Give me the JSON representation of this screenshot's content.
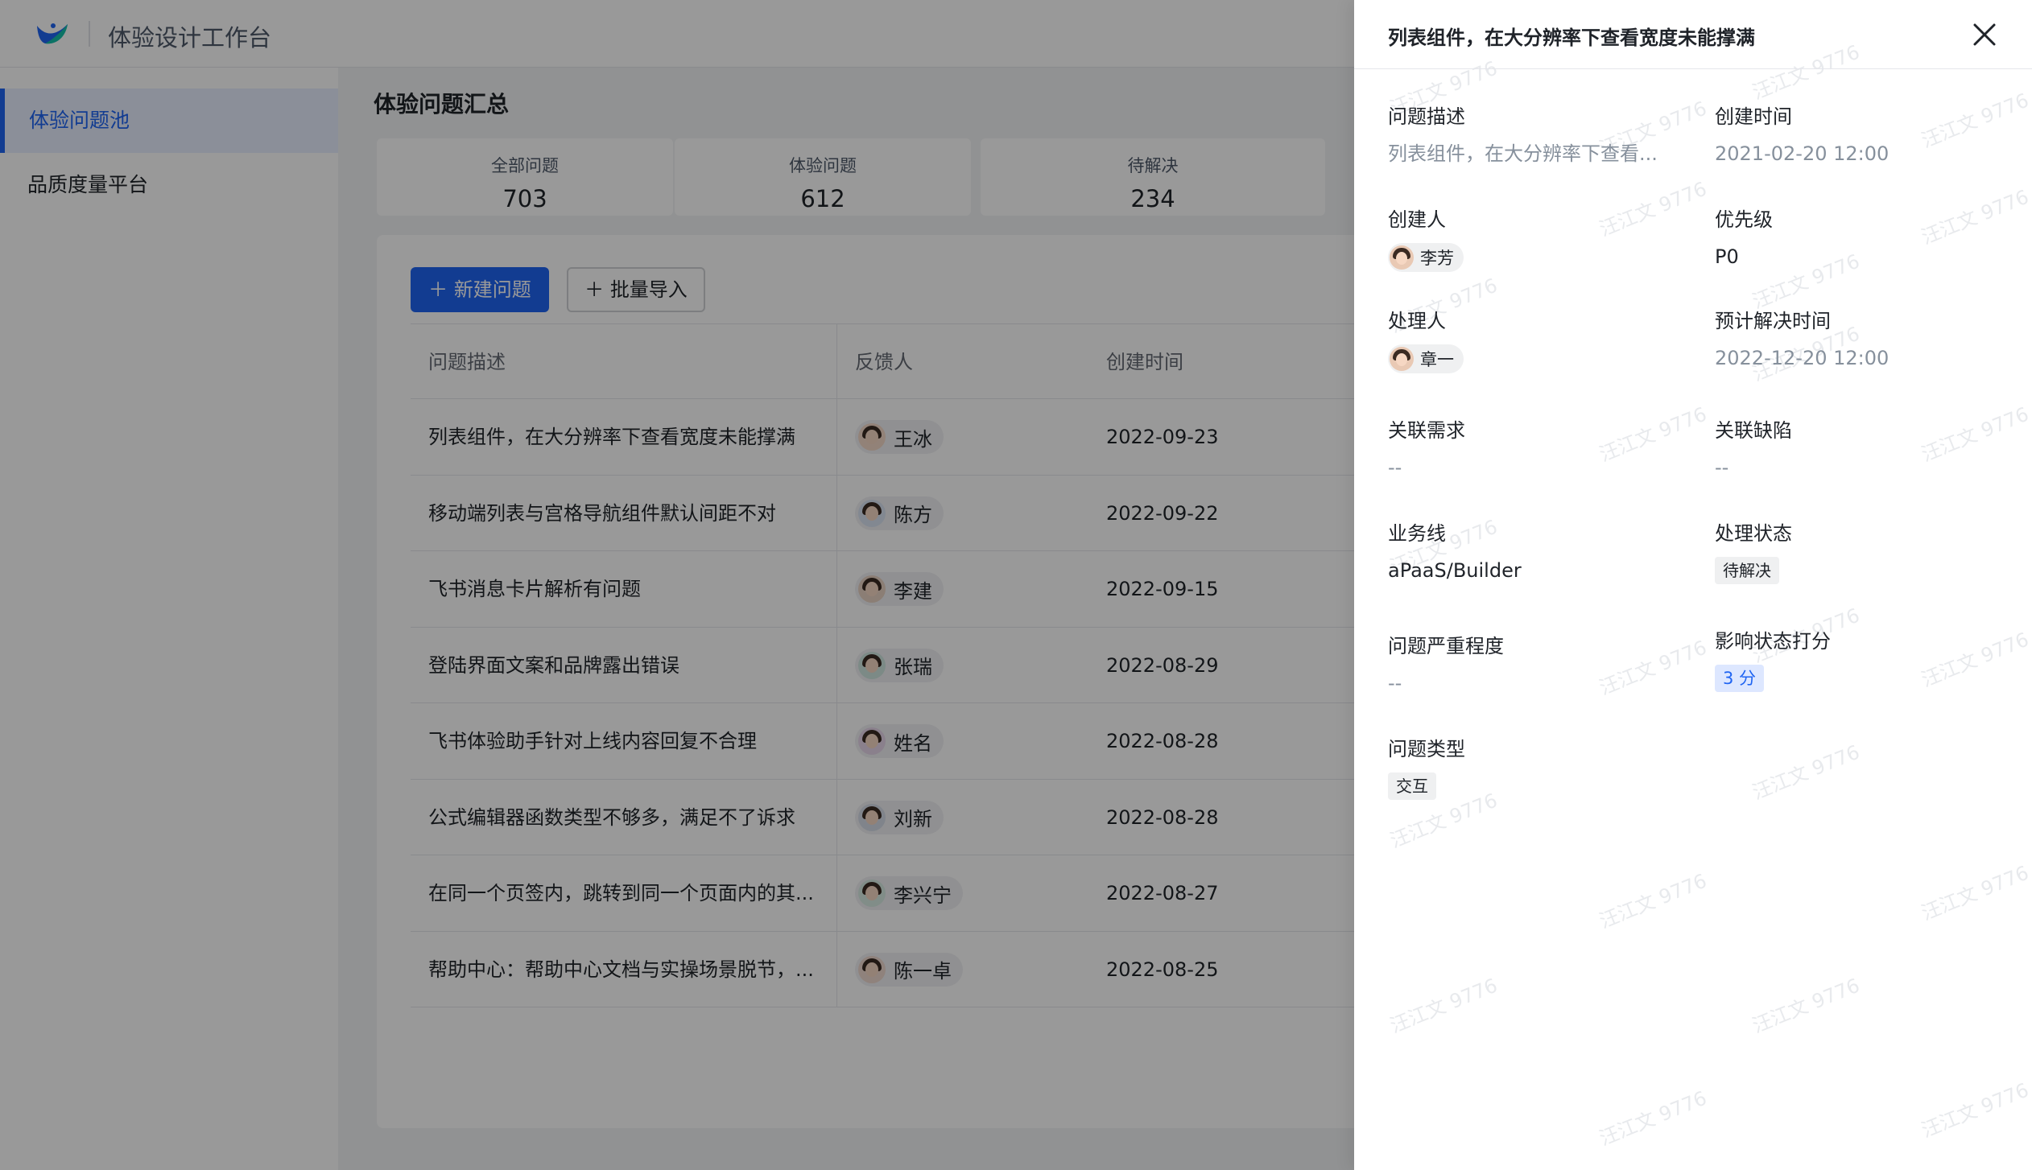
{
  "app": {
    "title": "体验设计工作台"
  },
  "sidebar": {
    "items": [
      {
        "label": "体验问题池",
        "active": true
      },
      {
        "label": "品质度量平台",
        "active": false
      }
    ]
  },
  "main": {
    "page_title": "体验问题汇总",
    "stats": [
      {
        "label": "全部问题",
        "value": "703"
      },
      {
        "label": "体验问题",
        "value": "612"
      },
      {
        "label": "待解决",
        "value": "234"
      }
    ],
    "buttons": {
      "new_issue": "新建问题",
      "batch_import": "批量导入"
    },
    "table": {
      "headers": {
        "description": "问题描述",
        "reporter": "反馈人",
        "created": "创建时间"
      },
      "rows": [
        {
          "description": "列表组件，在大分辨率下查看宽度未能撑满",
          "reporter": "王冰",
          "created": "2022-09-23"
        },
        {
          "description": "移动端列表与宫格导航组件默认间距不对",
          "reporter": "陈方",
          "created": "2022-09-22"
        },
        {
          "description": "飞书消息卡片解析有问题",
          "reporter": "李建",
          "created": "2022-09-15"
        },
        {
          "description": "登陆界面文案和品牌露出错误",
          "reporter": "张瑞",
          "created": "2022-08-29"
        },
        {
          "description": "飞书体验助手针对上线内容回复不合理",
          "reporter": "姓名",
          "created": "2022-08-28"
        },
        {
          "description": "公式编辑器函数类型不够多，满足不了诉求",
          "reporter": "刘新",
          "created": "2022-08-28"
        },
        {
          "description": "在同一个页签内，跳转到同一个页面内的其...",
          "reporter": "李兴宁",
          "created": "2022-08-27"
        },
        {
          "description": "帮助中心：帮助中心文档与实操场景脱节，...",
          "reporter": "陈一卓",
          "created": "2022-08-25"
        }
      ]
    }
  },
  "drawer": {
    "title": "列表组件，在大分辨率下查看宽度未能撑满",
    "fields": {
      "description": {
        "label": "问题描述",
        "value": "列表组件，在大分辨率下查看..."
      },
      "created_time": {
        "label": "创建时间",
        "value": "2021-02-20 12:00"
      },
      "creator": {
        "label": "创建人",
        "value": "李芳"
      },
      "priority": {
        "label": "优先级",
        "value": "P0"
      },
      "handler": {
        "label": "处理人",
        "value": "章一"
      },
      "expected_time": {
        "label": "预计解决时间",
        "value": "2022-12-20 12:00"
      },
      "related_req": {
        "label": "关联需求",
        "value": "--"
      },
      "related_bug": {
        "label": "关联缺陷",
        "value": "--"
      },
      "business_line": {
        "label": "业务线",
        "value": "aPaaS/Builder"
      },
      "status": {
        "label": "处理状态",
        "value": "待解决"
      },
      "severity": {
        "label": "问题严重程度",
        "value": "--"
      },
      "impact_score": {
        "label": "影响状态打分",
        "value": "3 分"
      },
      "issue_type": {
        "label": "问题类型",
        "value": "交互"
      }
    },
    "watermark": "汪江文 9776"
  },
  "colors": {
    "accent": "#1f64f2",
    "overlay": "rgba(0,0,0,0.4)"
  },
  "icons": {
    "logo": "app-logo",
    "close": "close-icon",
    "plus": "plus-icon"
  }
}
